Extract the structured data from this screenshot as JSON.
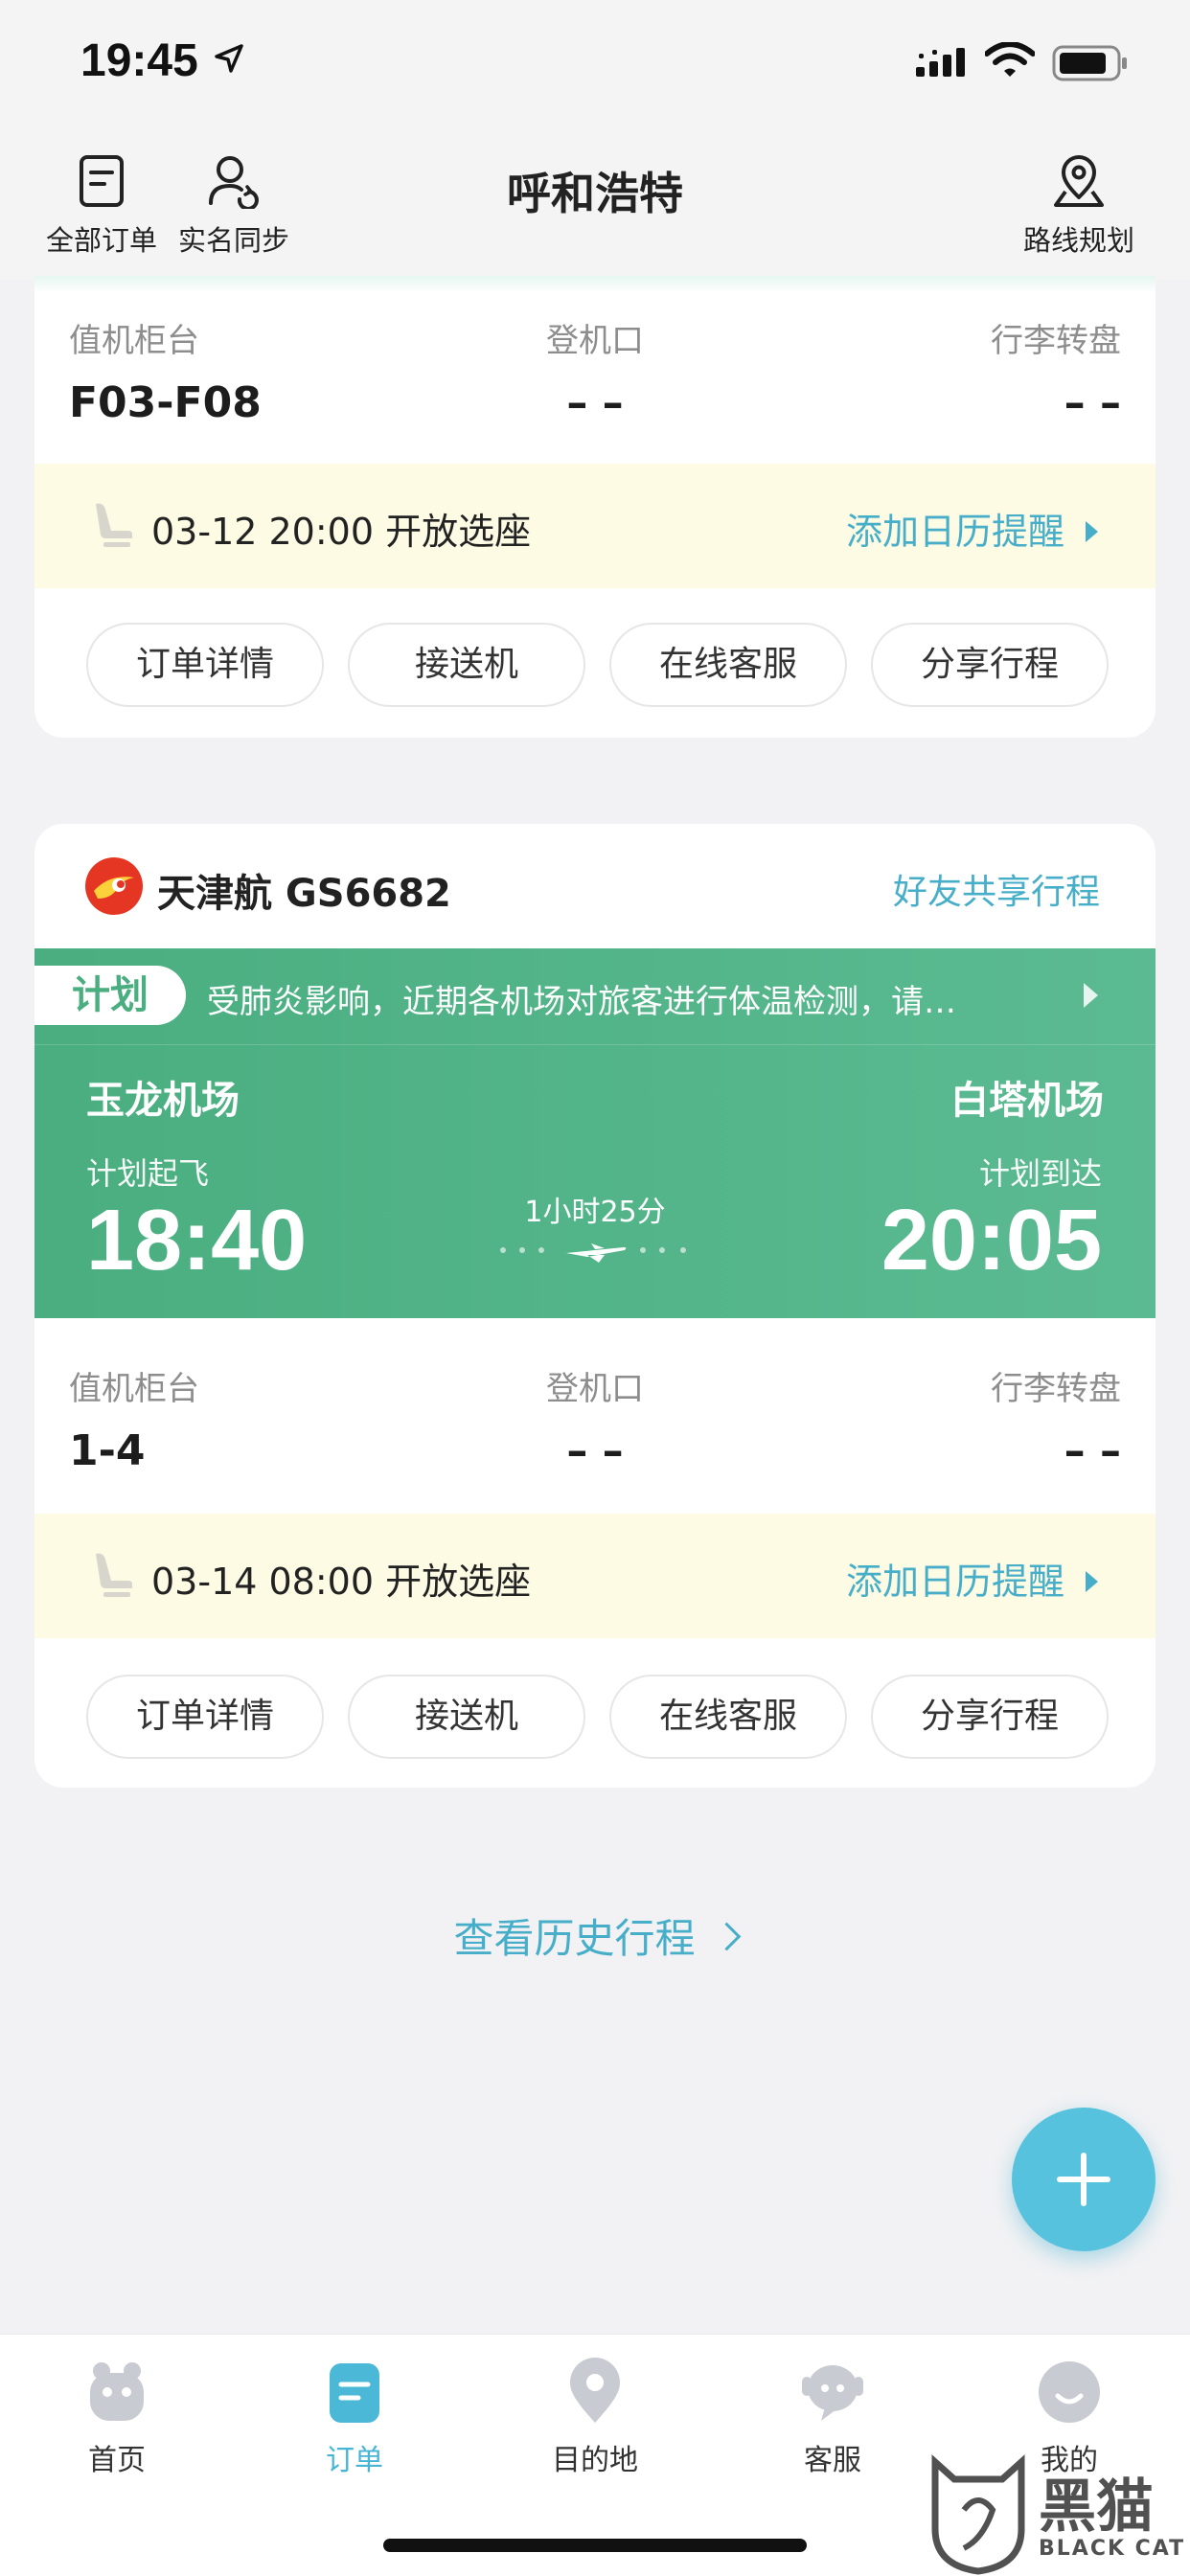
{
  "status_bar": {
    "time": "19:45"
  },
  "header": {
    "title": "呼和浩特",
    "left_buttons": [
      {
        "label": "全部订单",
        "icon": "document-icon"
      },
      {
        "label": "实名同步",
        "icon": "user-sync-icon"
      }
    ],
    "right_button": {
      "label": "路线规划",
      "icon": "map-pin-icon"
    }
  },
  "trip_1": {
    "info": {
      "checkin_label": "值机柜台",
      "checkin_value": "F03-F08",
      "gate_label": "登机口",
      "gate_value": "– –",
      "baggage_label": "行李转盘",
      "baggage_value": "– –"
    },
    "seat": {
      "text": "03-12 20:00 开放选座",
      "calendar_link": "添加日历提醒"
    },
    "actions": [
      "订单详情",
      "接送机",
      "在线客服",
      "分享行程"
    ]
  },
  "trip_2": {
    "flight_name": "天津航 GS6682",
    "share_link": "好友共享行程",
    "status_tag": "计划",
    "notice": "受肺炎影响，近期各机场对旅客进行体温检测，请…",
    "departure": {
      "airport": "玉龙机场",
      "label": "计划起飞",
      "time": "18:40"
    },
    "arrival": {
      "airport": "白塔机场",
      "label": "计划到达",
      "time": "20:05"
    },
    "duration": "1小时25分",
    "info": {
      "checkin_label": "值机柜台",
      "checkin_value": "1-4",
      "gate_label": "登机口",
      "gate_value": "– –",
      "baggage_label": "行李转盘",
      "baggage_value": "– –"
    },
    "seat": {
      "text": "03-14 08:00 开放选座",
      "calendar_link": "添加日历提醒"
    },
    "actions": [
      "订单详情",
      "接送机",
      "在线客服",
      "分享行程"
    ]
  },
  "history_link": "查看历史行程",
  "tab_bar": {
    "tabs": [
      {
        "label": "首页",
        "icon": "home-mascot-icon"
      },
      {
        "label": "订单",
        "icon": "order-icon",
        "active": true
      },
      {
        "label": "目的地",
        "icon": "location-icon"
      },
      {
        "label": "客服",
        "icon": "chat-bubble-icon"
      },
      {
        "label": "我的",
        "icon": "smiley-icon"
      }
    ]
  },
  "watermark": {
    "text": "黑猫",
    "sub": "BLACK CAT"
  },
  "colors": {
    "accent": "#47aec9",
    "green": "#4aae80",
    "fab": "#56c2de",
    "seat_bar": "#fdfbe3"
  }
}
